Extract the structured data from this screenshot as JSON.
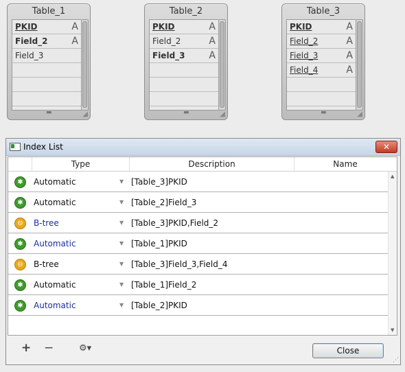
{
  "tables": [
    {
      "title": "Table_1",
      "fields": [
        {
          "name": "PKID",
          "style": "bold-underline",
          "type_icon": "A"
        },
        {
          "name": "Field_2",
          "style": "bold",
          "type_icon": "A"
        },
        {
          "name": "Field_3",
          "style": "normal",
          "type_icon": ""
        }
      ]
    },
    {
      "title": "Table_2",
      "fields": [
        {
          "name": "PKID",
          "style": "bold-underline",
          "type_icon": "A"
        },
        {
          "name": "Field_2",
          "style": "normal",
          "type_icon": "A"
        },
        {
          "name": "Field_3",
          "style": "bold",
          "type_icon": "A"
        }
      ]
    },
    {
      "title": "Table_3",
      "fields": [
        {
          "name": "PKID",
          "style": "bold-underline",
          "type_icon": "A"
        },
        {
          "name": "Field_2",
          "style": "underline",
          "type_icon": "A"
        },
        {
          "name": "Field_3",
          "style": "underline",
          "type_icon": "A"
        },
        {
          "name": "Field_4",
          "style": "underline",
          "type_icon": "A"
        }
      ]
    }
  ],
  "dialog": {
    "title": "Index List",
    "close_glyph": "✕",
    "columns": {
      "type": "Type",
      "description": "Description",
      "name": "Name"
    },
    "rows": [
      {
        "icon": "tree-icon",
        "icon_color": "#3e9b2b",
        "type": "Automatic",
        "type_blue": false,
        "description": "[Table_3]PKID",
        "name": ""
      },
      {
        "icon": "tree-icon",
        "icon_color": "#3e9b2b",
        "type": "Automatic",
        "type_blue": false,
        "description": "[Table_2]Field_3",
        "name": ""
      },
      {
        "icon": "link-icon",
        "icon_color": "#e9a919",
        "type": "B-tree",
        "type_blue": true,
        "description": "[Table_3]PKID,Field_2",
        "name": ""
      },
      {
        "icon": "tree-icon",
        "icon_color": "#3e9b2b",
        "type": "Automatic",
        "type_blue": true,
        "description": "[Table_1]PKID",
        "name": ""
      },
      {
        "icon": "link-icon",
        "icon_color": "#e9a919",
        "type": "B-tree",
        "type_blue": false,
        "description": "[Table_3]Field_3,Field_4",
        "name": ""
      },
      {
        "icon": "tree-icon",
        "icon_color": "#3e9b2b",
        "type": "Automatic",
        "type_blue": false,
        "description": "[Table_1]Field_2",
        "name": ""
      },
      {
        "icon": "tree-icon",
        "icon_color": "#3e9b2b",
        "type": "Automatic",
        "type_blue": true,
        "description": "[Table_2]PKID",
        "name": ""
      }
    ],
    "footer": {
      "add_label": "+",
      "remove_label": "−",
      "settings_label": "⚙▾",
      "close_button": "Close"
    }
  }
}
